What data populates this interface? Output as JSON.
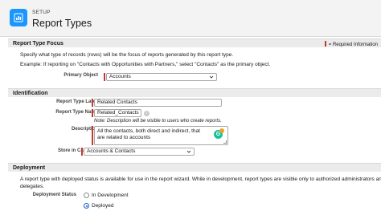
{
  "header": {
    "setup_label": "SETUP",
    "title": "Report Types"
  },
  "focus_section": {
    "title": "Report Type Focus",
    "required_legend": "= Required Information",
    "description": "Specify what type of records (rows) will be the focus of reports generated by this report type.",
    "example": "Example: If reporting on \"Contacts with Opportunities with Partners,\" select \"Contacts\" as the primary object.",
    "primary_object_label": "Primary Object",
    "primary_object_value": "Accounts"
  },
  "identification": {
    "title": "Identification",
    "label_label": "Report Type Label",
    "label_value": "Related Contacts",
    "name_label": "Report Type Name",
    "name_value": "Related_Contacts",
    "info_glyph": "i",
    "note": "Note: Description will be visible to users who create reports.",
    "description_label": "Description",
    "description_value": "All the contacts, both direct and indirect, that are related to accounts",
    "grammarly_glyph": "G",
    "category_label": "Store in Category",
    "category_value": "Accounts & Contacts"
  },
  "deployment": {
    "title": "Deployment",
    "description": "A report type with deployed status is available for use in the report wizard. While in development, report types are visible only to authorized administrators and their delegates.",
    "status_label": "Deployment Status",
    "options": [
      "In Development",
      "Deployed"
    ],
    "selected": "Deployed"
  },
  "colors": {
    "accent": "#1b96ff",
    "required": "#c23934",
    "grammarly": "#15c39a"
  }
}
